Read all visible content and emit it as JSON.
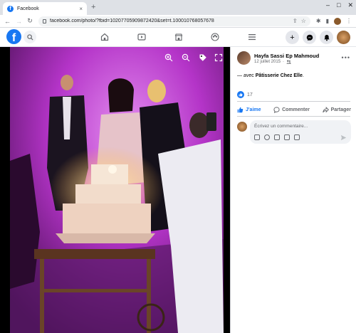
{
  "browser": {
    "tab_title": "Facebook",
    "tab_close": "×",
    "new_tab": "+",
    "url": "facebook.com/photo/?fbid=10207705909872420&set=t.100010768057678",
    "controls": [
      "–",
      "□",
      "✕"
    ]
  },
  "post": {
    "author": "Hayfa Sassi Ep Mahmoud",
    "date": "12 juillet 2015",
    "caption_prefix": "— avec ",
    "caption_tag": "Pâtisserie Chez Elle",
    "caption_suffix": ".",
    "like_count": "17"
  },
  "actions": {
    "like": "J'aime",
    "comment": "Commenter",
    "share": "Partager"
  },
  "comment": {
    "placeholder": "Écrivez un commentaire..."
  },
  "colors": {
    "brand": "#1877f2",
    "photo_glow": "#c23bd6"
  },
  "icons": {
    "photo_controls": [
      "zoom-in-icon",
      "zoom-out-icon",
      "tag-icon",
      "fullscreen-icon"
    ],
    "nav": [
      "home-icon",
      "video-icon",
      "marketplace-icon",
      "groups-icon",
      "menu-icon"
    ],
    "right": [
      "create-icon",
      "messenger-icon",
      "notifications-icon",
      "profile-avatar"
    ]
  }
}
